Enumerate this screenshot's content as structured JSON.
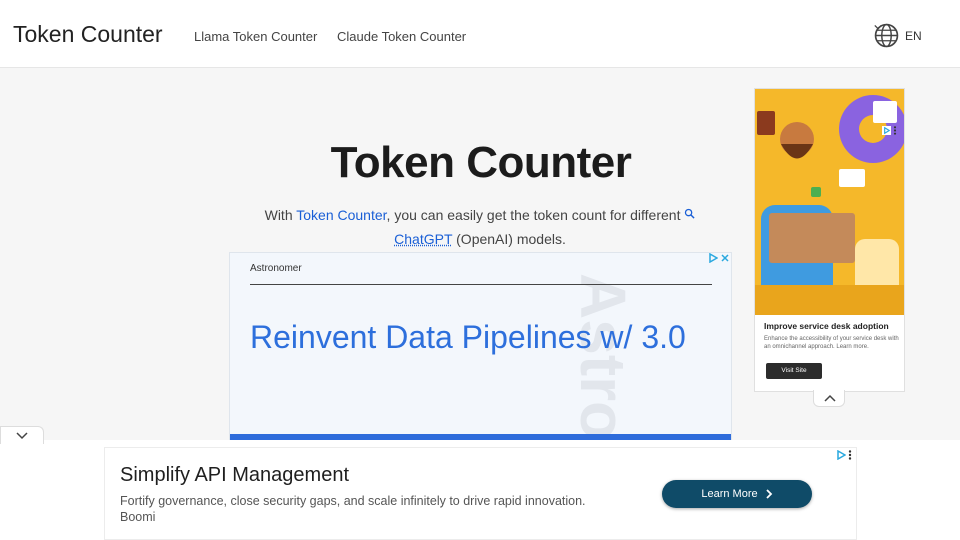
{
  "header": {
    "brand": "Token Counter",
    "nav": [
      {
        "label": "Llama Token Counter"
      },
      {
        "label": "Claude Token Counter"
      }
    ],
    "language": {
      "label": "EN",
      "icon": "globe-icon"
    }
  },
  "hero": {
    "title": "Token Counter",
    "description": {
      "prefix": "With ",
      "link1": "Token Counter",
      "middle": ", you can easily get the token count for different",
      "link2": "ChatGPT",
      "suffix": " (OpenAI) models."
    }
  },
  "ad_middle": {
    "advertiser": "Astronomer",
    "headline": "Reinvent Data Pipelines w/ 3.0",
    "watermark": "Astro"
  },
  "ad_side": {
    "title": "Improve service desk adoption",
    "body": "Enhance the accessibility of your service desk with an omnichannel approach. Learn more.",
    "cta": "Visit Site"
  },
  "ad_bottom": {
    "title": "Simplify API Management",
    "body": "Fortify governance, close security gaps, and scale infinitely to drive rapid innovation.",
    "advertiser": "Boomi",
    "cta": "Learn More"
  },
  "colors": {
    "link": "#1a5fd6",
    "ad_headline": "#2d6fdc",
    "cta_dark": "#0f4b68",
    "side_ad_bg": "#f5b82a"
  }
}
